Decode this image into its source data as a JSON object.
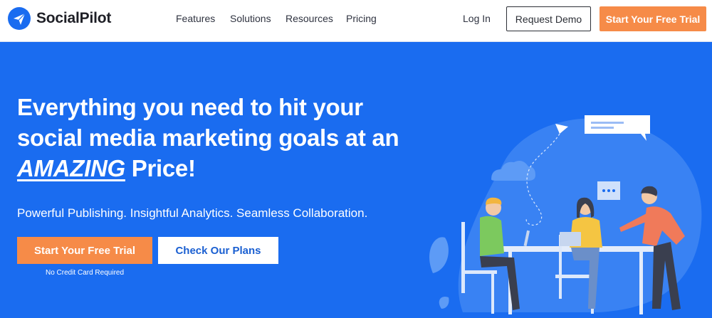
{
  "nav": {
    "brand": "SocialPilot",
    "links": [
      "Features",
      "Solutions",
      "Resources",
      "Pricing"
    ],
    "login": "Log In",
    "request_demo": "Request Demo",
    "free_trial": "Start Your Free Trial"
  },
  "hero": {
    "headline_line1": "Everything you need to hit your",
    "headline_line2": "social media marketing goals at an",
    "headline_emphasis": "AMAZING",
    "headline_tail": " Price!",
    "subheadline": "Powerful Publishing. Insightful Analytics. Seamless Collaboration.",
    "primary_cta": "Start Your Free Trial",
    "secondary_cta": "Check Our Plans",
    "note": "No Credit Card Required"
  },
  "colors": {
    "hero_bg": "#1a6cf0",
    "accent_orange": "#f68b48",
    "brand_blue": "#1a6cf0"
  },
  "icons": {
    "logo": "paper-plane-logo-icon"
  }
}
